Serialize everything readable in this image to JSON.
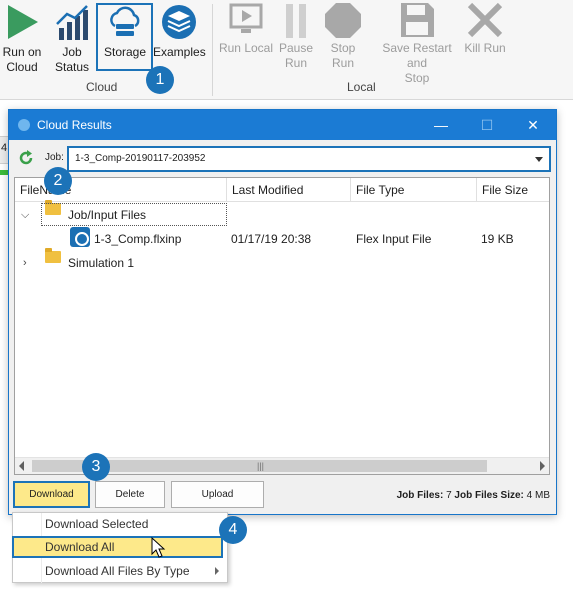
{
  "ribbon": {
    "cloud_group": {
      "label": "Cloud",
      "buttons": [
        {
          "line1": "Run on",
          "line2": "Cloud",
          "icon": "play-icon"
        },
        {
          "line1": "Job",
          "line2": "Status",
          "icon": "chart-icon"
        },
        {
          "line1": "Storage",
          "icon": "cloud-storage-icon"
        },
        {
          "line1": "Examples",
          "icon": "stack-icon"
        }
      ]
    },
    "local_group": {
      "label": "Local",
      "buttons": [
        {
          "line1": "Run Local",
          "icon": "monitor-icon"
        },
        {
          "line1": "Pause",
          "line2": "Run",
          "icon": "pause-icon"
        },
        {
          "line1": "Stop",
          "line2": "Run",
          "icon": "stop-icon"
        },
        {
          "line1": "Save Restart and",
          "line2": "Stop",
          "icon": "save-icon"
        },
        {
          "line1": "Kill Run",
          "icon": "x-icon"
        }
      ]
    }
  },
  "background": {
    "partial_text": "4"
  },
  "badges": [
    "1",
    "2",
    "3",
    "4"
  ],
  "dialog": {
    "title": "Cloud Results",
    "window_controls": {
      "minimize": "—",
      "maximize": "☐",
      "close": "✕"
    },
    "job_label": "Job:",
    "job_value": "1-3_Comp-20190117-203952",
    "columns": [
      "FileName",
      "Last Modified",
      "File Type",
      "File Size"
    ],
    "rows": [
      {
        "name": "Job/Input Files",
        "expanded": true,
        "type": "folder"
      },
      {
        "name": "1-3_Comp.flxinp",
        "modified": "01/17/19 20:38",
        "file_type": "Flex Input File",
        "size": "19 KB"
      },
      {
        "name": "Simulation 1",
        "expanded": false,
        "type": "folder"
      }
    ],
    "buttons": {
      "download": "Download",
      "delete": "Delete",
      "upload": "Upload"
    },
    "stats": {
      "job_files_label": "Job Files:",
      "job_files": "7",
      "size_label": "Job Files Size:",
      "size": "4 MB"
    }
  },
  "menu": {
    "items": [
      "Download Selected",
      "Download All",
      "Download All Files By Type"
    ],
    "highlighted": "Download All"
  },
  "colors": {
    "accent": "#1c73b8",
    "title_bar": "#1b7bd4",
    "highlight": "#fde98a"
  }
}
